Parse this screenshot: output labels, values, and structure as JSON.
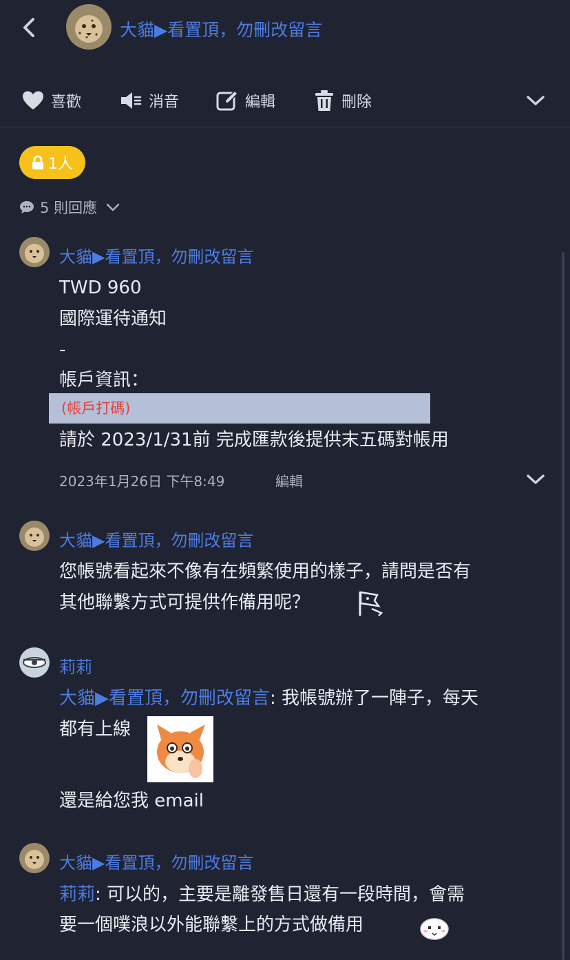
{
  "header": {
    "title": "大貓▶看置頂，勿刪改留言"
  },
  "toolbar": {
    "like": "喜歡",
    "mute": "消音",
    "edit": "編輯",
    "delete": "刪除"
  },
  "post": {
    "privacy_badge": "1人",
    "reply_count": "5 則回應"
  },
  "replies": [
    {
      "author": "大貓▶看置頂，勿刪改留言",
      "lines": [
        "TWD 960",
        "國際運待通知",
        "-",
        "帳戶資訊："
      ],
      "redacted_label": "(帳戶打碼)",
      "last_line": "請於 2023/1/31前 完成匯款後提供末五碼對帳用",
      "timestamp": "2023年1月26日 下午8:49",
      "edit_label": "編輯"
    },
    {
      "author": "大貓▶看置頂，勿刪改留言",
      "line1": "您帳號看起來不像有在頻繁使用的樣子，請問是否有",
      "line2": "其他聯繫方式可提供作備用呢？"
    },
    {
      "author": "莉莉",
      "mention": "大貓▶看置頂，勿刪改留言",
      "line1_rest": ": 我帳號辦了一陣子，每天",
      "line2": "都有上線",
      "line3": "還是給您我 email"
    },
    {
      "author": "大貓▶看置頂，勿刪改留言",
      "mention": "莉莉",
      "line1_rest": ": 可以的，主要是離發售日還有一段時間，會需",
      "line2": "要一個噗浪以外能聯繫上的方式做備用"
    }
  ],
  "colors": {
    "background": "#1f2332",
    "accent_blue": "#4d7ce0",
    "badge_yellow": "#f7c11b",
    "redacted_bg": "#b4bfd8",
    "redacted_text": "#e0463f"
  }
}
